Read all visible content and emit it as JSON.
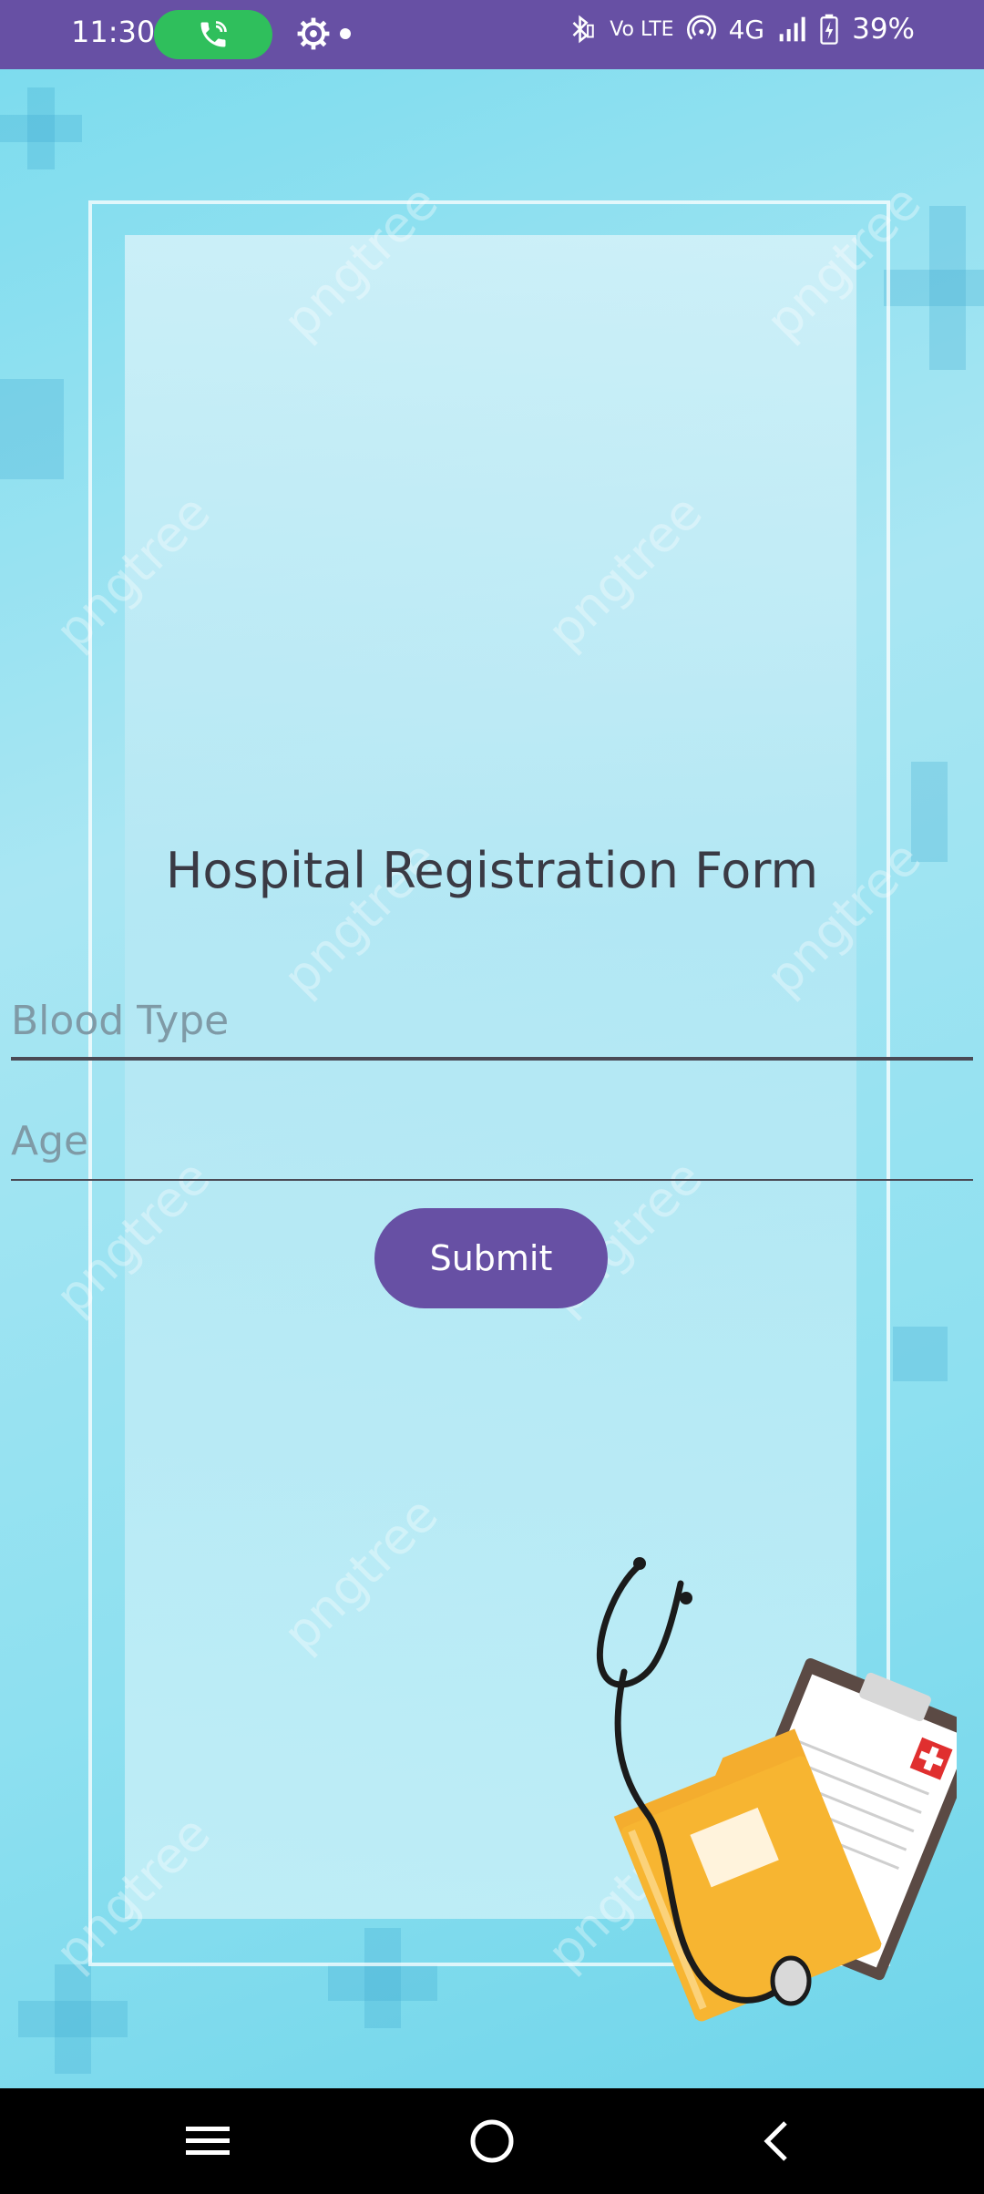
{
  "status_bar": {
    "time": "11:30",
    "network": "4G",
    "volte": "Vo LTE",
    "battery": "39%",
    "icons": [
      "phone-call-icon",
      "settings-icon",
      "bluetooth-icon",
      "hotspot-icon",
      "signal-icon",
      "battery-icon"
    ],
    "color": "#6750a4"
  },
  "form": {
    "title": "Hospital Registration Form",
    "blood_type": {
      "placeholder": "Blood Type",
      "value": ""
    },
    "age": {
      "placeholder": "Age",
      "value": ""
    },
    "submit_label": "Submit",
    "accent": "#6750a4"
  },
  "background": {
    "watermark_text": "pngtree"
  },
  "nav": {
    "icons": [
      "menu-icon",
      "home-icon",
      "back-icon"
    ]
  }
}
